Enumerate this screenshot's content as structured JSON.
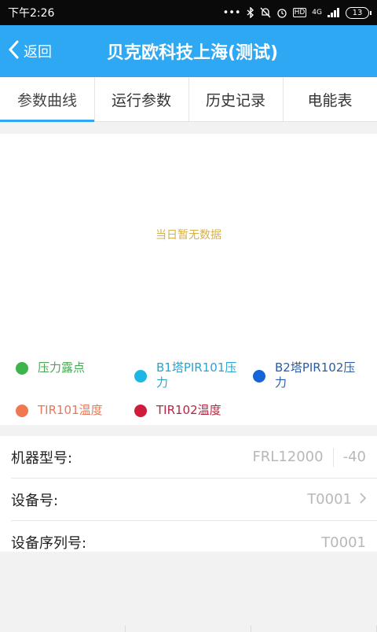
{
  "status": {
    "time": "下午2:26",
    "network_label": "4G",
    "hd_label": "HD",
    "battery": "13"
  },
  "header": {
    "back_label": "返回",
    "title": "贝克欧科技上海(测试)"
  },
  "tabs": [
    {
      "label": "参数曲线",
      "active": true
    },
    {
      "label": "运行参数",
      "active": false
    },
    {
      "label": "历史记录",
      "active": false
    },
    {
      "label": "电能表",
      "active": false
    }
  ],
  "chart": {
    "empty_text": "当日暂无数据"
  },
  "legend": [
    {
      "label": "压力露点",
      "color": "#3cb54a",
      "text_color": "#4aa655"
    },
    {
      "label": "B1塔PIR101压力",
      "color": "#1eb7e3",
      "text_color": "#2aa5d2"
    },
    {
      "label": "B2塔PIR102压力",
      "color": "#1565d8",
      "text_color": "#2a5da8"
    },
    {
      "label": "TIR101温度",
      "color": "#f07850",
      "text_color": "#e3795a"
    },
    {
      "label": "TIR102温度",
      "color": "#d01c3c",
      "text_color": "#b52640"
    }
  ],
  "info": {
    "model_label": "机器型号:",
    "model_value": "FRL12000",
    "model_extra": "-40",
    "device_label": "设备号:",
    "device_value": "T0001",
    "serial_label": "设备序列号:",
    "serial_value": "T0001"
  },
  "icons": {
    "back": "chevron-left-icon",
    "device_row": "chevron-right-icon"
  }
}
